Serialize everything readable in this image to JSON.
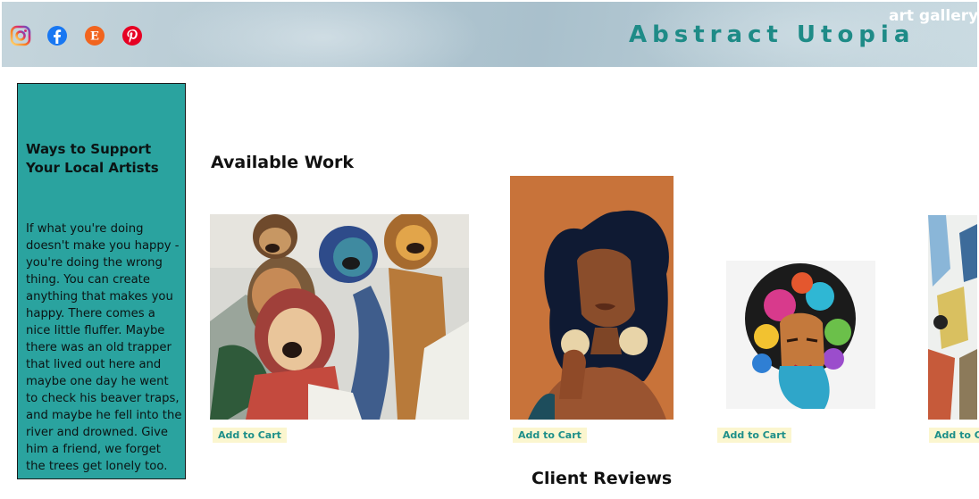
{
  "header": {
    "brand": "Abstract Utopia",
    "tagline": "art gallery",
    "social": [
      {
        "icon": "instagram-icon",
        "color": "#c13584"
      },
      {
        "icon": "facebook-icon",
        "color": "#1877f2"
      },
      {
        "icon": "etsy-icon",
        "color": "#f1641e"
      },
      {
        "icon": "pinterest-icon",
        "color": "#e60023"
      }
    ]
  },
  "sidebar": {
    "title": "Ways to Support Your Local Artists",
    "body": "If what you're doing doesn't make you happy - you're doing the wrong thing. You can create anything that makes you happy. There comes a nice little fluffer. Maybe there was an old trapper that lived out here and maybe one day he went to check his beaver traps, and maybe he fell into the river and drowned. Give him a friend, we forget the trees get lonely too."
  },
  "main": {
    "section_title": "Available Work",
    "reviews_title": "Client Reviews",
    "artworks": [
      {
        "add_label": "Add to Cart"
      },
      {
        "add_label": "Add to Cart"
      },
      {
        "add_label": "Add to Cart"
      },
      {
        "add_label": "Add to Cart"
      }
    ]
  },
  "colors": {
    "accent": "#2aa39f",
    "brand_text": "#1e8b87",
    "cart_bg": "#fbf6cf"
  }
}
